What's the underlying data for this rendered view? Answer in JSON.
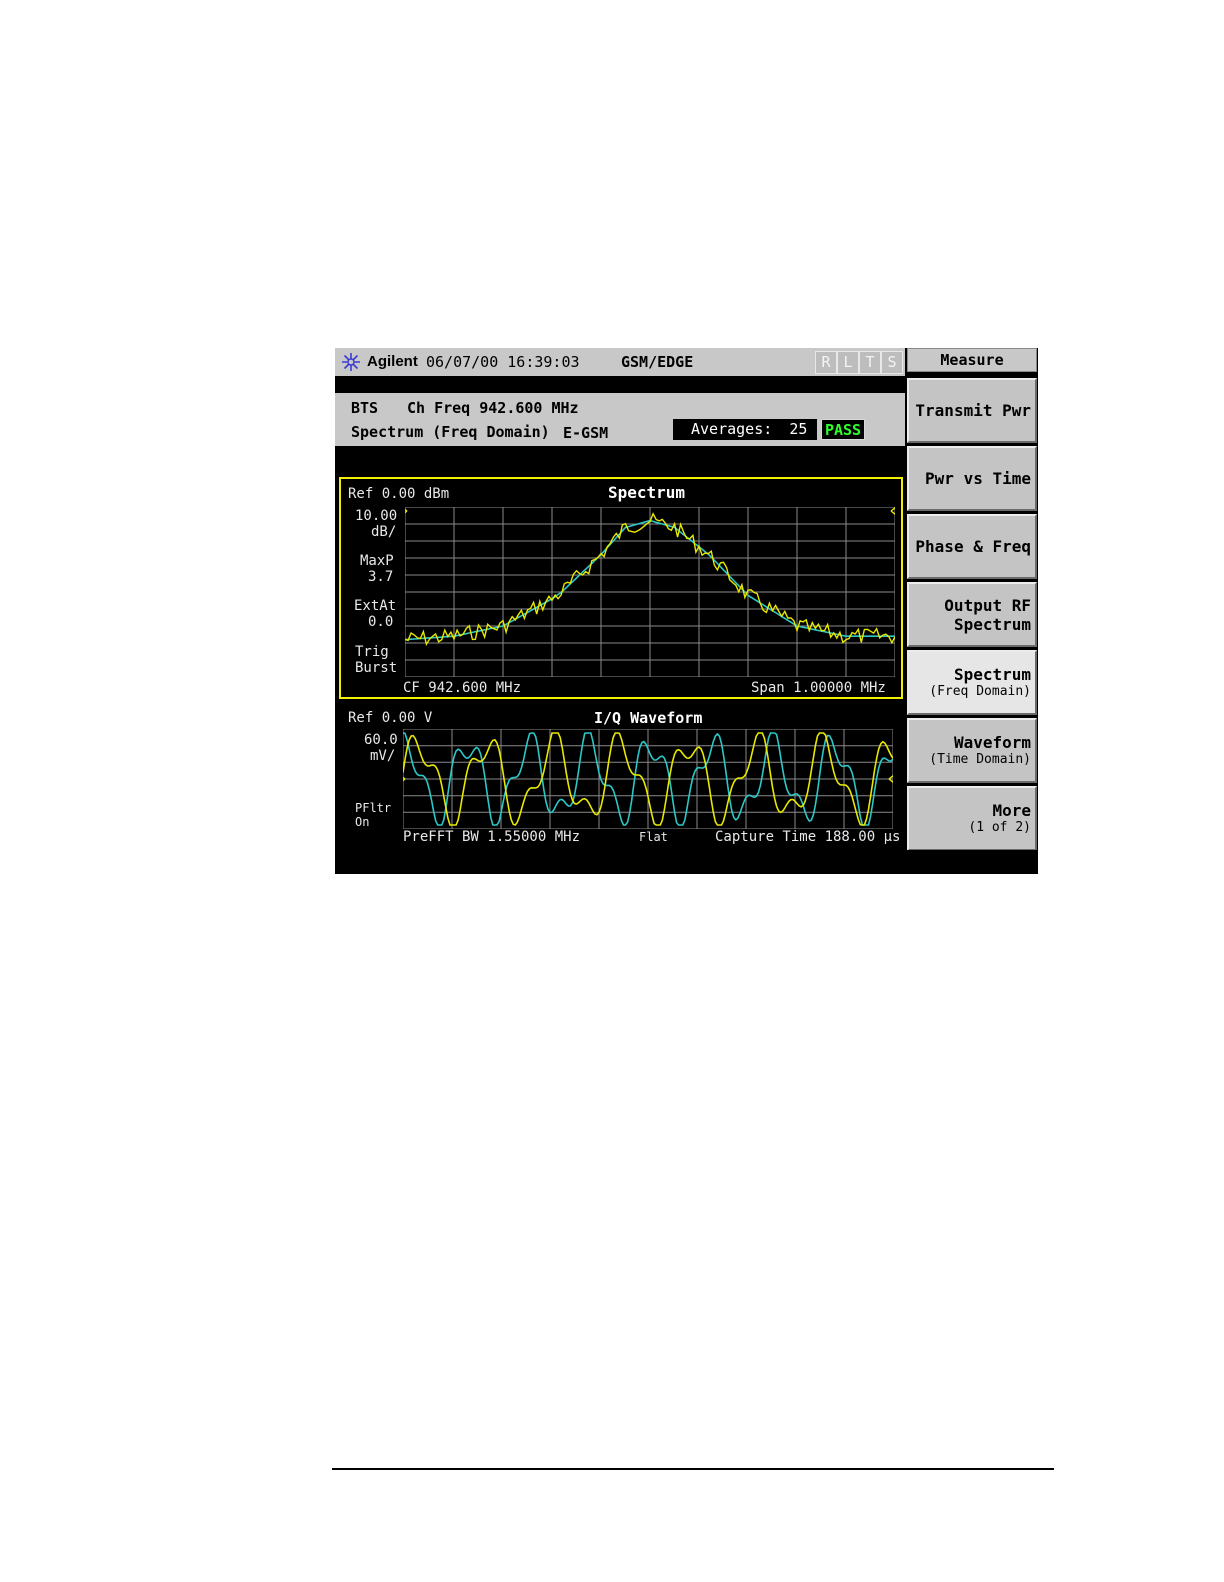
{
  "titlebar": {
    "brand": "Agilent",
    "datetime": "06/07/00 16:39:03",
    "mode": "GSM/EDGE",
    "flags": [
      "R",
      "L",
      "T",
      "S"
    ]
  },
  "info": {
    "line1_left": "BTS",
    "line1_right": "Ch Freq 942.600 MHz",
    "line2_left": "Spectrum (Freq Domain)",
    "line2_right": "E-GSM",
    "averages_label": "Averages:",
    "averages_value": "25",
    "status": "PASS"
  },
  "spectrum": {
    "title": "Spectrum",
    "ref": "Ref 0.00 dBm",
    "scale_value": "10.00",
    "scale_unit": "dB/",
    "maxp_label": "MaxP",
    "maxp_value": "3.7",
    "extat_label": "ExtAt",
    "extat_value": "0.0",
    "trig_label": "Trig",
    "trig_value": "Burst",
    "cf": "CF 942.600 MHz",
    "span": "Span  1.00000 MHz"
  },
  "iq": {
    "title": "I/Q Waveform",
    "ref": "Ref 0.00  V",
    "scale_value": "60.0",
    "scale_unit": "mV/",
    "pfltr_label": "PFltr",
    "pfltr_value": "On",
    "prefft": "PreFFT BW 1.55000 MHz",
    "flat": "Flat",
    "capture": "Capture Time 188.00 μs"
  },
  "softkeys": {
    "title": "Measure",
    "keys": [
      {
        "main": "Transmit Pwr",
        "sub": ""
      },
      {
        "main": "Pwr vs Time",
        "sub": ""
      },
      {
        "main": "Phase & Freq",
        "sub": ""
      },
      {
        "main": "Output RF",
        "sub": "Spectrum"
      },
      {
        "main": "Spectrum",
        "sub": "(Freq Domain)"
      },
      {
        "main": "Waveform",
        "sub": "(Time Domain)"
      },
      {
        "main": "More",
        "sub": "(1 of 2)"
      }
    ]
  },
  "colors": {
    "trace_yellow": "#e8e800",
    "trace_cyan": "#2cc8c8",
    "grid": "#8a8a8a",
    "pass_green": "#2cff2c",
    "panel_border": "#f0f000"
  },
  "icons": {
    "logo": "agilent-spark-icon"
  }
}
